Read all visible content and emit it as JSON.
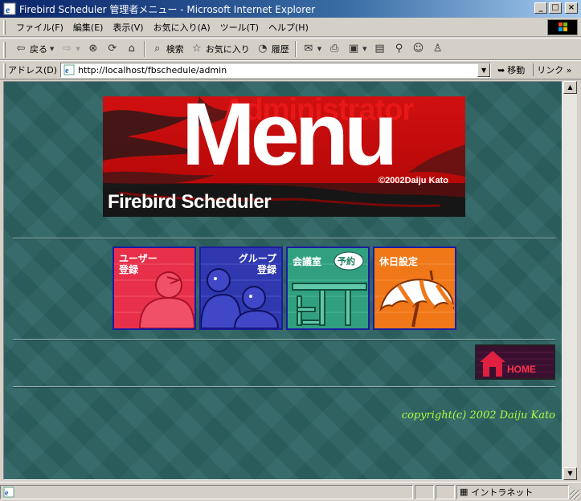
{
  "window": {
    "title": "Firebird Scheduler 管理者メニュー - Microsoft Internet Explorer",
    "min_label": "_",
    "max_label": "□",
    "close_label": "×"
  },
  "menubar": {
    "items": [
      "ファイル(F)",
      "編集(E)",
      "表示(V)",
      "お気に入り(A)",
      "ツール(T)",
      "ヘルプ(H)"
    ]
  },
  "toolbar": {
    "back_label": "戻る",
    "search_label": "検索",
    "favorites_label": "お気に入り",
    "history_label": "履歴"
  },
  "address": {
    "label": "アドレス(D)",
    "url": "http://localhost/fbschedule/admin",
    "go_label": "移動",
    "links_label": "リンク »"
  },
  "banner": {
    "title_top": "Administrator",
    "title_main": "Menu",
    "copyright": "©2002Daiju Kato",
    "brand": "Firebird Scheduler"
  },
  "tiles": [
    {
      "label_line1": "ユーザー",
      "label_line2": "登録",
      "color": "#e8304a"
    },
    {
      "label_line1": "グループ",
      "label_line2": "登録",
      "color": "#3038b0"
    },
    {
      "label_line1": "会議室",
      "label_line2": "",
      "badge": "予約",
      "color": "#30a080"
    },
    {
      "label_line1": "休日設定",
      "label_line2": "",
      "color": "#f07818"
    }
  ],
  "home": {
    "label": "HOME"
  },
  "copyright": "copyright(c) 2002 Daiju Kato",
  "status": {
    "zone_label": "イントラネット"
  }
}
